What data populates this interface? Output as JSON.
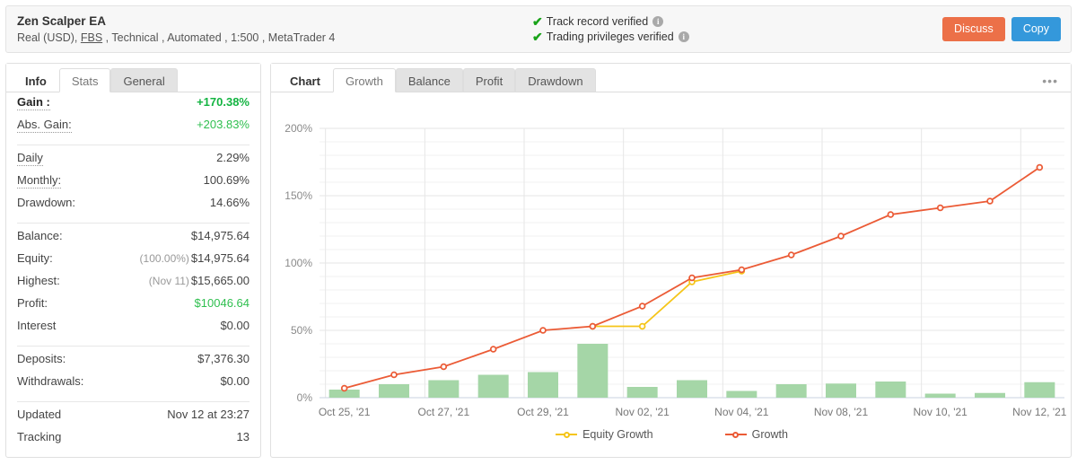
{
  "header": {
    "title": "Zen Scalper EA",
    "subtitle_parts": [
      "Real (USD),",
      "FBS",
      ", Technical , Automated , 1:500 , MetaTrader 4"
    ],
    "verified": [
      {
        "label": "Track record verified",
        "icon": "check-icon",
        "info": "i"
      },
      {
        "label": "Trading privileges verified",
        "icon": "check-icon",
        "info": "i"
      }
    ],
    "discuss_label": "Discuss",
    "copy_label": "Copy",
    "discuss_color": "#ec7048",
    "copy_color": "#3498db",
    "check_color": "#19a319"
  },
  "sidebar": {
    "tabs": [
      {
        "label": "Info",
        "state": "plain"
      },
      {
        "label": "Stats",
        "state": "active"
      },
      {
        "label": "General",
        "state": "inactive"
      }
    ],
    "groups": [
      {
        "rows": [
          {
            "key": "Gain :",
            "value": "+170.38%",
            "style": "greenb",
            "dotted": true,
            "bold": true
          },
          {
            "key": "Abs. Gain:",
            "value": "+203.83%",
            "style": "green",
            "dotted": true
          }
        ]
      },
      {
        "rows": [
          {
            "key": "Daily",
            "value": "2.29%",
            "dotted": true
          },
          {
            "key": "Monthly:",
            "value": "100.69%",
            "dotted": true
          },
          {
            "key": "Drawdown:",
            "value": "14.66%"
          }
        ]
      },
      {
        "rows": [
          {
            "key": "Balance:",
            "value": "$14,975.64"
          },
          {
            "key": "Equity:",
            "value": "$14,975.64",
            "prefix": "(100.00%)"
          },
          {
            "key": "Highest:",
            "value": "$15,665.00",
            "prefix": "(Nov 11)"
          },
          {
            "key": "Profit:",
            "value": "$10046.64",
            "style": "green"
          },
          {
            "key": "Interest",
            "value": "$0.00"
          }
        ]
      },
      {
        "rows": [
          {
            "key": "Deposits:",
            "value": "$7,376.30"
          },
          {
            "key": "Withdrawals:",
            "value": "$0.00"
          }
        ]
      },
      {
        "rows": [
          {
            "key": "Updated",
            "value": "Nov 12 at 23:27"
          },
          {
            "key": "Tracking",
            "value": "13"
          }
        ]
      }
    ]
  },
  "main": {
    "tabs": [
      {
        "label": "Chart",
        "state": "plain"
      },
      {
        "label": "Growth",
        "state": "active"
      },
      {
        "label": "Balance",
        "state": "inactive"
      },
      {
        "label": "Profit",
        "state": "inactive"
      },
      {
        "label": "Drawdown",
        "state": "inactive"
      }
    ],
    "more_icon": "ellipsis-icon"
  },
  "chart_data": {
    "type": "line",
    "title": "",
    "xlabel": "",
    "ylabel": "",
    "ylim": [
      0,
      200
    ],
    "yticks": [
      0,
      50,
      100,
      150,
      200
    ],
    "ytick_labels": [
      "0%",
      "50%",
      "100%",
      "150%",
      "200%"
    ],
    "grid": true,
    "legend_position": "bottom",
    "x": [
      "Oct 25, '21",
      "Oct 26, '21",
      "Oct 27, '21",
      "Oct 28, '21",
      "Oct 29, '21",
      "Nov 01, '21",
      "Nov 02, '21",
      "Nov 03, '21",
      "Nov 04, '21",
      "Nov 05, '21",
      "Nov 08, '21",
      "Nov 09, '21",
      "Nov 10, '21",
      "Nov 11, '21",
      "Nov 12, '21"
    ],
    "xtick_labels": [
      "Oct 25, '21",
      "Oct 27, '21",
      "Oct 29, '21",
      "Nov 02, '21",
      "Nov 04, '21",
      "Nov 08, '21",
      "Nov 10, '21",
      "Nov 12, '21"
    ],
    "xtick_indices": [
      0,
      2,
      4,
      6,
      8,
      10,
      12,
      14
    ],
    "series": [
      {
        "name": "Growth",
        "type": "line",
        "color": "#eb5b36",
        "values": [
          7,
          17,
          23,
          36,
          50,
          53,
          68,
          89,
          95,
          106,
          120,
          136,
          141,
          146,
          171
        ]
      },
      {
        "name": "Equity Growth",
        "type": "line",
        "color": "#f5c518",
        "values": [
          null,
          null,
          null,
          null,
          null,
          53,
          53,
          86,
          94,
          null,
          null,
          null,
          null,
          null,
          null
        ]
      },
      {
        "name": "Daily Profit Bars",
        "type": "bar",
        "color": "#a5d6a7",
        "show_in_legend": false,
        "values": [
          6,
          10,
          13,
          17,
          19,
          40,
          8,
          13,
          5,
          10,
          10.5,
          12,
          3,
          3.5,
          11.5
        ]
      }
    ]
  }
}
